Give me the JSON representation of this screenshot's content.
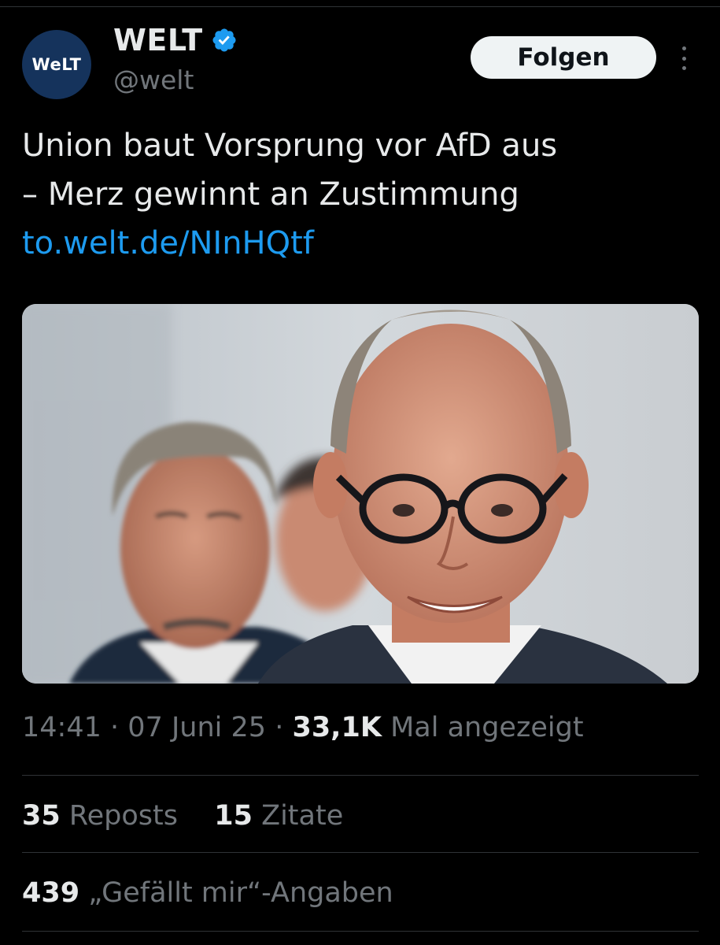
{
  "account": {
    "avatar_text": "WeLT",
    "display_name": "WELT",
    "handle": "@welt",
    "verified_icon": "verified-badge-icon",
    "follow_label": "Folgen"
  },
  "tweet": {
    "text_line_1": "Union baut Vorsprung vor AfD aus",
    "text_line_2": "– Merz gewinnt an Zustimmung",
    "link": "to.welt.de/NInHQtf"
  },
  "meta": {
    "time": "14:41",
    "separator": "·",
    "date": "07 Juni 25",
    "views_count": "33,1K",
    "views_label": "Mal angezeigt"
  },
  "stats": {
    "reposts_count": "35",
    "reposts_label": "Reposts",
    "quotes_count": "15",
    "quotes_label": "Zitate",
    "likes_count": "439",
    "likes_label": "„Gefällt mir“-Angaben"
  },
  "colors": {
    "background": "#000000",
    "text_primary": "#e7e9ea",
    "text_secondary": "#71767b",
    "link": "#1d9bf0",
    "verified": "#1d9bf0",
    "avatar_bg": "#15335c",
    "divider": "#2f3336"
  }
}
